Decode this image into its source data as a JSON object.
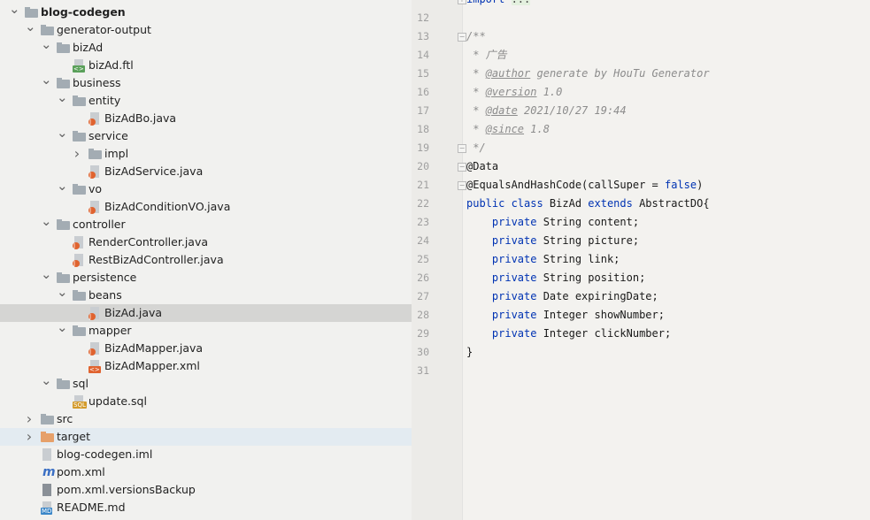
{
  "project_tree": {
    "items": [
      {
        "label": "blog-codegen",
        "depth": 0,
        "state": "open",
        "icon": "module-icon",
        "bold": true
      },
      {
        "label": "generator-output",
        "depth": 1,
        "state": "open",
        "icon": "folder-icon"
      },
      {
        "label": "bizAd",
        "depth": 2,
        "state": "open",
        "icon": "folder-icon"
      },
      {
        "label": "bizAd.ftl",
        "depth": 3,
        "icon": "ftl-file-icon"
      },
      {
        "label": "business",
        "depth": 2,
        "state": "open",
        "icon": "folder-icon"
      },
      {
        "label": "entity",
        "depth": 3,
        "state": "open",
        "icon": "folder-icon"
      },
      {
        "label": "BizAdBo.java",
        "depth": 4,
        "icon": "java-file-icon"
      },
      {
        "label": "service",
        "depth": 3,
        "state": "open",
        "icon": "folder-icon"
      },
      {
        "label": "impl",
        "depth": 4,
        "state": "closed",
        "icon": "folder-icon"
      },
      {
        "label": "BizAdService.java",
        "depth": 4,
        "icon": "java-file-icon"
      },
      {
        "label": "vo",
        "depth": 3,
        "state": "open",
        "icon": "folder-icon"
      },
      {
        "label": "BizAdConditionVO.java",
        "depth": 4,
        "icon": "java-file-icon"
      },
      {
        "label": "controller",
        "depth": 2,
        "state": "open",
        "icon": "folder-icon"
      },
      {
        "label": "RenderController.java",
        "depth": 3,
        "icon": "java-file-icon"
      },
      {
        "label": "RestBizAdController.java",
        "depth": 3,
        "icon": "java-file-icon"
      },
      {
        "label": "persistence",
        "depth": 2,
        "state": "open",
        "icon": "folder-icon"
      },
      {
        "label": "beans",
        "depth": 3,
        "state": "open",
        "icon": "folder-icon"
      },
      {
        "label": "BizAd.java",
        "depth": 4,
        "icon": "java-file-icon",
        "selected": true
      },
      {
        "label": "mapper",
        "depth": 3,
        "state": "open",
        "icon": "folder-icon"
      },
      {
        "label": "BizAdMapper.java",
        "depth": 4,
        "icon": "java-file-icon"
      },
      {
        "label": "BizAdMapper.xml",
        "depth": 4,
        "icon": "xml-file-icon"
      },
      {
        "label": "sql",
        "depth": 2,
        "state": "open",
        "icon": "folder-icon"
      },
      {
        "label": "update.sql",
        "depth": 3,
        "icon": "sql-file-icon"
      },
      {
        "label": "src",
        "depth": 1,
        "state": "closed",
        "icon": "folder-icon"
      },
      {
        "label": "target",
        "depth": 1,
        "state": "closed",
        "icon": "excluded-folder-icon",
        "highlighted": true
      },
      {
        "label": "blog-codegen.iml",
        "depth": 1,
        "icon": "iml-file-icon"
      },
      {
        "label": "pom.xml",
        "depth": 1,
        "icon": "maven-file-icon"
      },
      {
        "label": "pom.xml.versionsBackup",
        "depth": 1,
        "icon": "text-file-icon"
      },
      {
        "label": "README.md",
        "depth": 1,
        "icon": "markdown-file-icon"
      }
    ]
  },
  "editor": {
    "lines": [
      {
        "n": "",
        "fold": "+",
        "tokens": [
          {
            "t": "import ",
            "c": "kw"
          },
          {
            "t": "...",
            "c": "fold-txt"
          }
        ]
      },
      {
        "n": "12",
        "tokens": []
      },
      {
        "n": "13",
        "fold": "-",
        "tokens": [
          {
            "t": "/**",
            "c": "cm"
          }
        ]
      },
      {
        "n": "14",
        "tokens": [
          {
            "t": " * 广告",
            "c": "cm"
          }
        ]
      },
      {
        "n": "15",
        "tokens": [
          {
            "t": " * ",
            "c": "cm"
          },
          {
            "t": "@author",
            "c": "tag"
          },
          {
            "t": " generate by HouTu Generator",
            "c": "cm"
          }
        ]
      },
      {
        "n": "16",
        "tokens": [
          {
            "t": " * ",
            "c": "cm"
          },
          {
            "t": "@version",
            "c": "tag"
          },
          {
            "t": " 1.0",
            "c": "cm"
          }
        ]
      },
      {
        "n": "17",
        "tokens": [
          {
            "t": " * ",
            "c": "cm"
          },
          {
            "t": "@date",
            "c": "tag"
          },
          {
            "t": " 2021/10/27 19:44",
            "c": "cm"
          }
        ]
      },
      {
        "n": "18",
        "tokens": [
          {
            "t": " * ",
            "c": "cm"
          },
          {
            "t": "@since",
            "c": "tag"
          },
          {
            "t": " 1.8",
            "c": "cm"
          }
        ]
      },
      {
        "n": "19",
        "fold": "-",
        "tokens": [
          {
            "t": " */",
            "c": "cm"
          }
        ]
      },
      {
        "n": "20",
        "fold": "-",
        "tokens": [
          {
            "t": "@Data",
            "c": "an"
          }
        ]
      },
      {
        "n": "21",
        "fold": "-",
        "tokens": [
          {
            "t": "@EqualsAndHashCode(callSuper = ",
            "c": "an"
          },
          {
            "t": "false",
            "c": "kw"
          },
          {
            "t": ")",
            "c": "an"
          }
        ]
      },
      {
        "n": "22",
        "tokens": [
          {
            "t": "public class ",
            "c": "kw"
          },
          {
            "t": "BizAd ",
            "c": ""
          },
          {
            "t": "extends ",
            "c": "kw"
          },
          {
            "t": "AbstractDO{",
            "c": ""
          }
        ]
      },
      {
        "n": "23",
        "tokens": [
          {
            "t": "    private ",
            "c": "kw"
          },
          {
            "t": "String content;",
            "c": ""
          }
        ]
      },
      {
        "n": "24",
        "tokens": [
          {
            "t": "    private ",
            "c": "kw"
          },
          {
            "t": "String picture;",
            "c": ""
          }
        ]
      },
      {
        "n": "25",
        "tokens": [
          {
            "t": "    private ",
            "c": "kw"
          },
          {
            "t": "String link;",
            "c": ""
          }
        ]
      },
      {
        "n": "26",
        "tokens": [
          {
            "t": "    private ",
            "c": "kw"
          },
          {
            "t": "String position;",
            "c": ""
          }
        ]
      },
      {
        "n": "27",
        "tokens": [
          {
            "t": "    private ",
            "c": "kw"
          },
          {
            "t": "Date expiringDate;",
            "c": ""
          }
        ]
      },
      {
        "n": "28",
        "tokens": [
          {
            "t": "    private ",
            "c": "kw"
          },
          {
            "t": "Integer showNumber;",
            "c": ""
          }
        ]
      },
      {
        "n": "29",
        "tokens": [
          {
            "t": "    private ",
            "c": "kw"
          },
          {
            "t": "Integer clickNumber;",
            "c": ""
          }
        ]
      },
      {
        "n": "30",
        "tokens": [
          {
            "t": "}",
            "c": ""
          }
        ]
      },
      {
        "n": "31",
        "tokens": []
      }
    ]
  }
}
